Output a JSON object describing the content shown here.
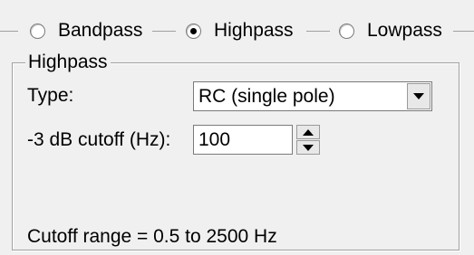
{
  "filter_mode": {
    "options": [
      {
        "label": "Bandpass",
        "selected": false
      },
      {
        "label": "Highpass",
        "selected": true
      },
      {
        "label": "Lowpass",
        "selected": false
      }
    ]
  },
  "group": {
    "title": "Highpass",
    "type_label": "Type:",
    "type_value": "RC (single pole)",
    "cutoff_label": "-3 dB cutoff (Hz):",
    "cutoff_value": "100",
    "range_text": "Cutoff range = 0.5 to 2500 Hz"
  }
}
